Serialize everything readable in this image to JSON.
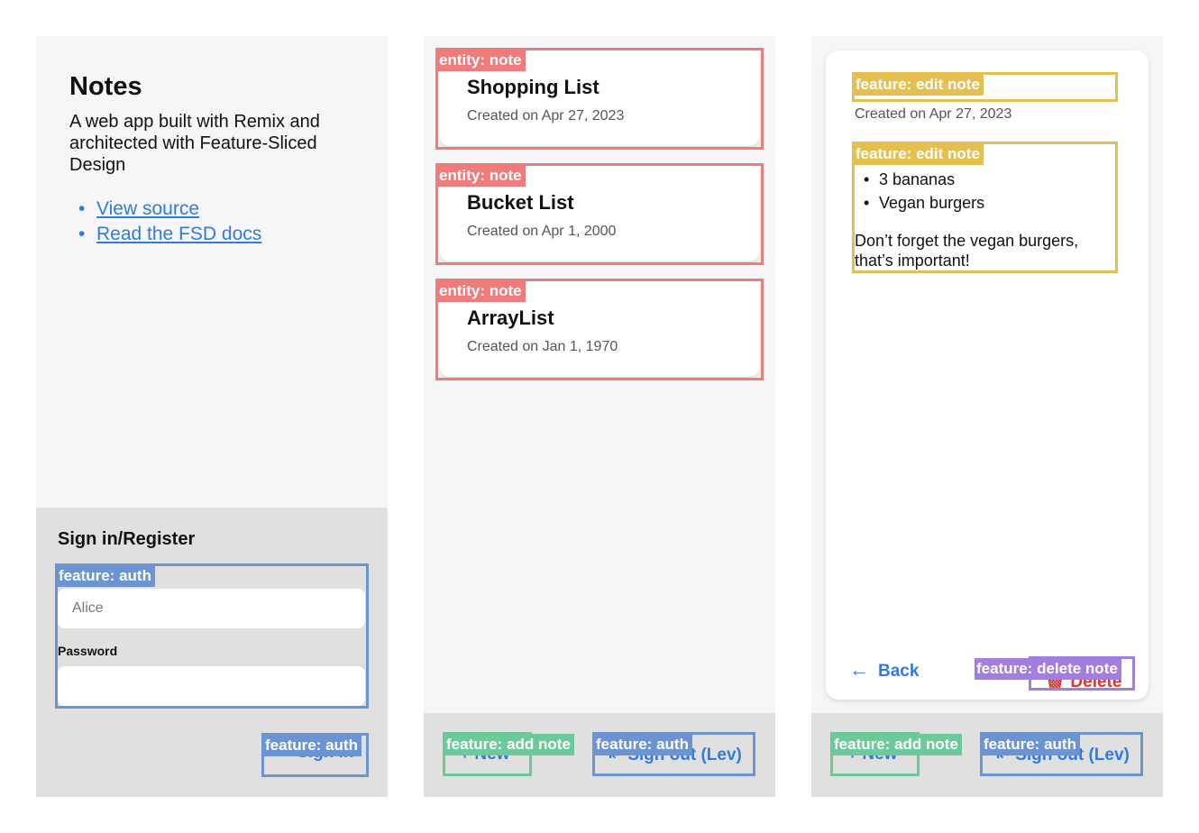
{
  "screen1": {
    "app_title": "Notes",
    "description": "A web app built with Remix and architected with Feature-Sliced Design",
    "links": [
      {
        "label": "View source"
      },
      {
        "label": "Read the FSD docs"
      }
    ],
    "auth": {
      "heading": "Sign in/Register",
      "username_value": "Alice",
      "password_label": "Password",
      "password_value": "",
      "sign_in_label": "Sign in",
      "sign_in_icon": "sign-in-icon"
    }
  },
  "screen2": {
    "notes": [
      {
        "title": "Shopping List",
        "date": "Created on Apr 27, 2023"
      },
      {
        "title": "Bucket List",
        "date": "Created on Apr 1, 2000"
      },
      {
        "title": "ArrayList",
        "date": "Created on Jan 1, 1970"
      }
    ],
    "new_label": "New",
    "new_icon": "plus-icon",
    "sign_out_label": "Sign out (Lev)",
    "sign_out_icon": "sign-out-icon"
  },
  "screen3": {
    "note_title": "",
    "date": "Created on Apr 27, 2023",
    "list_items": [
      "3 bananas",
      "Vegan burgers"
    ],
    "paragraph": "Don’t forget the vegan burgers, that’s important!",
    "back_label": "Back",
    "back_icon": "arrow-left-icon",
    "delete_label": "Delete",
    "delete_icon": "trash-icon",
    "new_label": "New",
    "sign_out_label": "Sign out (Lev)"
  },
  "overlays": {
    "entity_note": "entity: note",
    "feature_auth": "feature: auth",
    "feature_add_note": "feature: add note",
    "feature_edit_note": "feature: edit note",
    "feature_delete_note": "feature: delete note"
  },
  "colors": {
    "link_blue": "#2f7be0",
    "entity_red": "#ef7b7b",
    "feature_blue": "#6c94d2",
    "feature_green": "#6cc99a",
    "feature_yellow": "#e5c050",
    "feature_purple": "#a37de0",
    "danger_red": "#dd3333"
  }
}
